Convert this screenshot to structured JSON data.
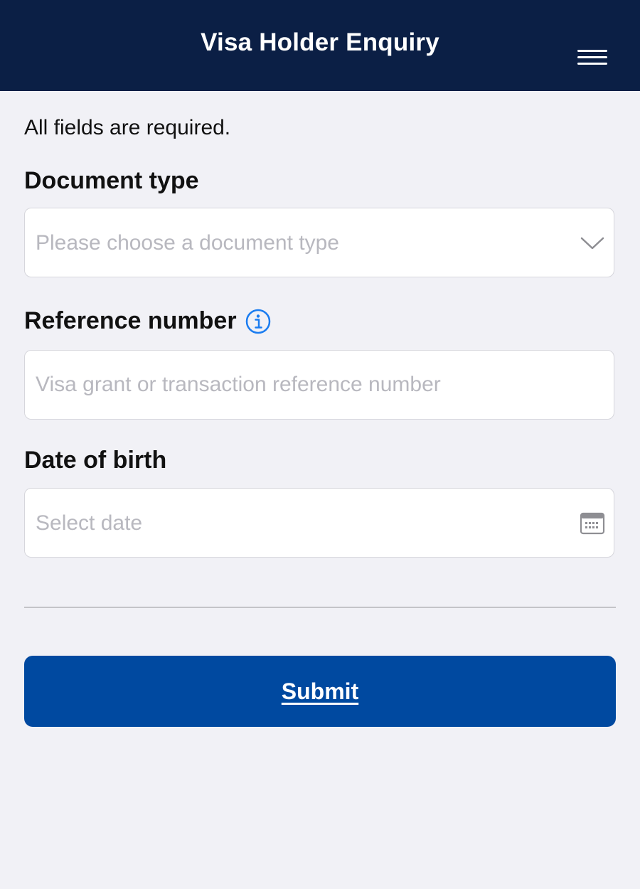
{
  "header": {
    "title": "Visa Holder Enquiry",
    "menu_icon": "hamburger-menu-icon",
    "background_color": "#0b1f45"
  },
  "form": {
    "required_note": "All fields are required.",
    "document_type": {
      "label": "Document type",
      "placeholder": "Please choose a document type",
      "icon": "chevron-down-icon"
    },
    "reference_number": {
      "label": "Reference number",
      "placeholder": "Visa grant or transaction reference number",
      "info_icon": "info-icon"
    },
    "date_of_birth": {
      "label": "Date of birth",
      "placeholder": "Select date",
      "icon": "calendar-icon"
    },
    "submit_label": "Submit"
  },
  "colors": {
    "accent": "#0049a0",
    "info_icon": "#1a7cf0",
    "page_background": "#f1f1f6"
  }
}
